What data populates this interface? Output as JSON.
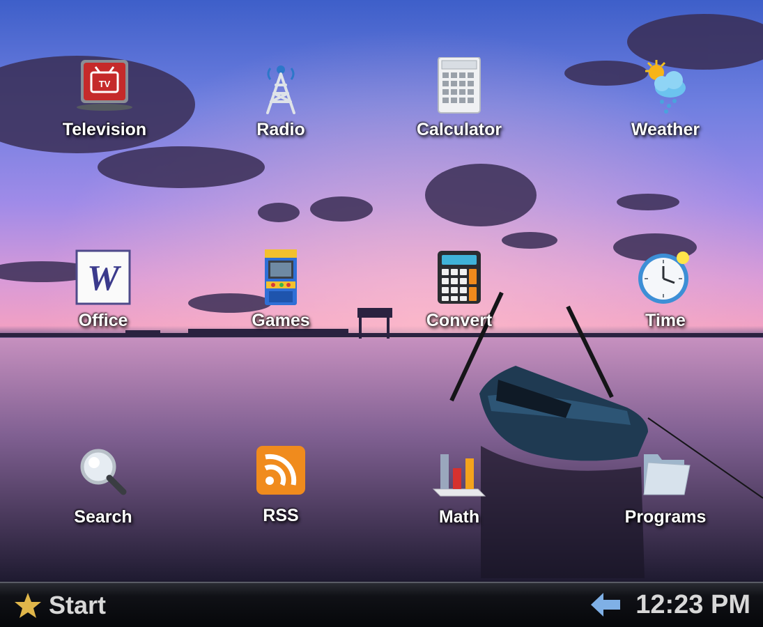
{
  "desktop": {
    "apps": [
      {
        "label": "Television",
        "icon": "television-icon"
      },
      {
        "label": "Radio",
        "icon": "radio-tower-icon"
      },
      {
        "label": "Calculator",
        "icon": "calculator-icon"
      },
      {
        "label": "Weather",
        "icon": "weather-icon"
      },
      {
        "label": "Office",
        "icon": "office-icon",
        "icon_text": "W"
      },
      {
        "label": "Games",
        "icon": "arcade-icon"
      },
      {
        "label": "Convert",
        "icon": "convert-calculator-icon"
      },
      {
        "label": "Time",
        "icon": "clock-icon"
      },
      {
        "label": "Search",
        "icon": "magnifier-icon"
      },
      {
        "label": "RSS",
        "icon": "rss-icon"
      },
      {
        "label": "Math",
        "icon": "bar-chart-icon"
      },
      {
        "label": "Programs",
        "icon": "folder-icon"
      }
    ]
  },
  "taskbar": {
    "start_label": "Start",
    "start_icon": "star-icon",
    "back_icon": "back-arrow-icon",
    "clock": "12:23 PM"
  },
  "colors": {
    "taskbar": "#0b0c10",
    "taskbar_text": "#d8d8d8",
    "star": "#e0b64a",
    "back_arrow": "#7fb0e6"
  }
}
